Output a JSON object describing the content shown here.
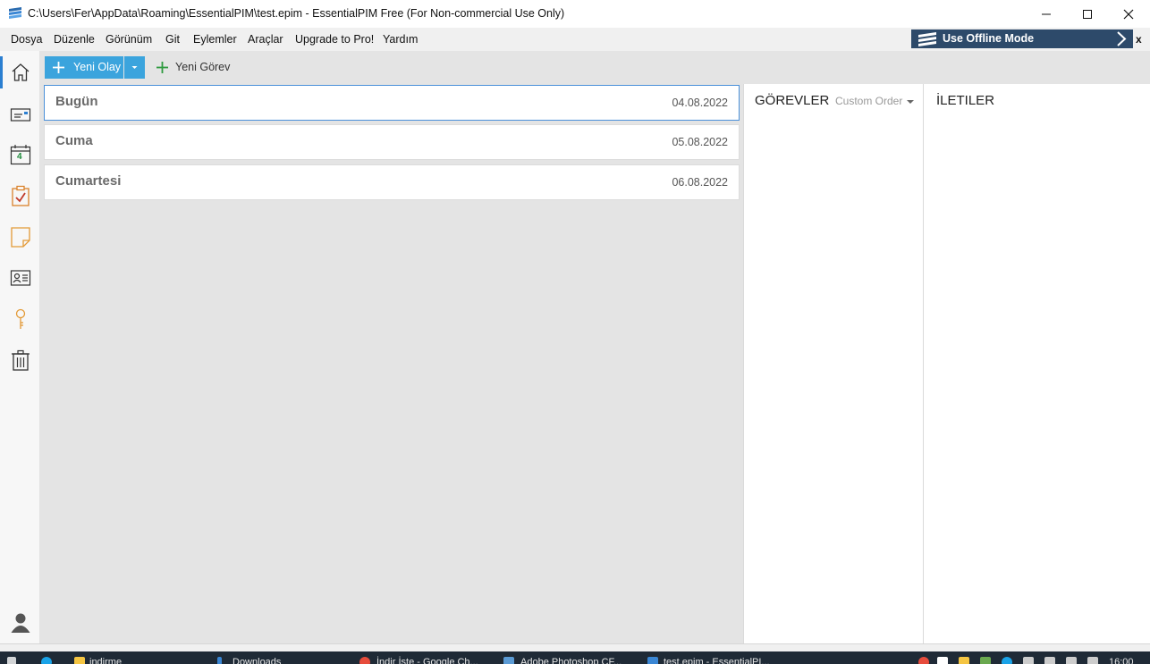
{
  "window": {
    "title": "C:\\Users\\Fer\\AppData\\Roaming\\EssentialPIM\\test.epim - EssentialPIM Free (For Non-commercial Use Only)"
  },
  "menu": {
    "items": [
      "Dosya",
      "Düzenle",
      "Görünüm",
      "Git",
      "Eylemler",
      "Araçlar",
      "Upgrade to Pro!",
      "Yardım"
    ]
  },
  "offline_banner": {
    "label": "Use Offline Mode",
    "close": "x",
    "color": "#2d4a6a"
  },
  "toolbar": {
    "new_event_label": "Yeni Olay",
    "new_task_label": "Yeni Görev",
    "accent_color": "#3ba4dd"
  },
  "sidebar": {
    "icons": [
      "home-icon",
      "mail-icon",
      "calendar-icon",
      "tasks-icon",
      "notes-icon",
      "contacts-icon",
      "passwords-icon",
      "trash-icon",
      "user-icon"
    ],
    "calendar_day": "4"
  },
  "days": [
    {
      "name": "Bugün",
      "date": "04.08.2022"
    },
    {
      "name": "Cuma",
      "date": "05.08.2022"
    },
    {
      "name": "Cumartesi",
      "date": "06.08.2022"
    }
  ],
  "tasks_panel": {
    "title": "GÖREVLER",
    "order": "Custom Order"
  },
  "messages_panel": {
    "title": "İLETILER"
  },
  "taskbar": {
    "items": [
      "indirme",
      "Downloads",
      "İndir İste - Google Ch...",
      "Adobe Photoshop CF...",
      "test.epim - EssentialPI..."
    ],
    "clock": "16:00"
  }
}
